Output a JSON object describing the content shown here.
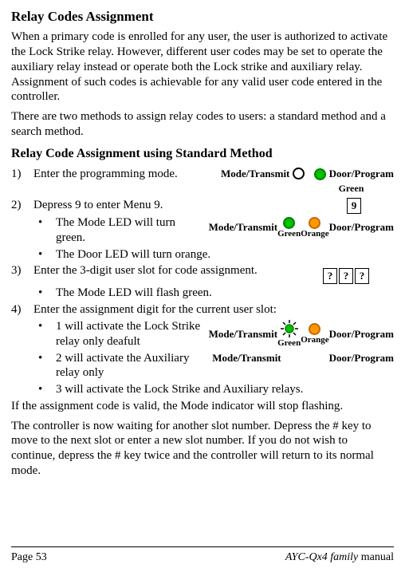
{
  "title": "Relay Codes Assignment",
  "para1": "When a primary code is enrolled for any user, the user is authorized to activate the Lock Strike relay. However, different user codes may be set to operate the auxiliary relay instead or operate both the Lock strike and auxiliary relay.  Assignment of such codes is achievable for any valid user code entered in the controller.",
  "para2": "There are two methods to assign relay codes to users: a standard method and a search method.",
  "subtitle": "Relay Code Assignment using Standard Method",
  "step1_num": "1)",
  "step1_text": "Enter the programming mode.",
  "step2_num": "2)",
  "step2_text": "Depress 9 to enter Menu 9.",
  "step2_b1": "The Mode LED will turn green.",
  "step2_b2": "The Door LED will turn orange.",
  "step3_num": "3)",
  "step3_text": "Enter the 3-digit user slot for code assignment.",
  "step3_b1": "The Mode LED will flash green.",
  "step4_num": "4)",
  "step4_text": "Enter the assignment digit for the current user slot:",
  "step4_b1": "1 will activate the Lock Strike relay only deafult",
  "step4_b2": "2 will activate the Auxiliary relay only",
  "step4_b3": "3 will activate the Lock Strike and Auxiliary relays.",
  "para3": "If the assignment code is valid, the Mode indicator will stop flashing.",
  "para4": "The controller is now waiting for another slot number. Depress the # key to move to the next slot or enter a new slot number. If you do not wish to continue, depress the # key twice and the controller will return to its normal mode.",
  "led_mode": "Mode/Transmit",
  "led_door": "Door/Program",
  "color_green": "Green",
  "color_orange": "Orange",
  "key9": "9",
  "keyq": "?",
  "footer_left": "Page 53",
  "footer_right_prefix": "AYC-Qx4",
  "footer_right_middle": " family ",
  "footer_right_suffix": "manual",
  "bullet": "•"
}
